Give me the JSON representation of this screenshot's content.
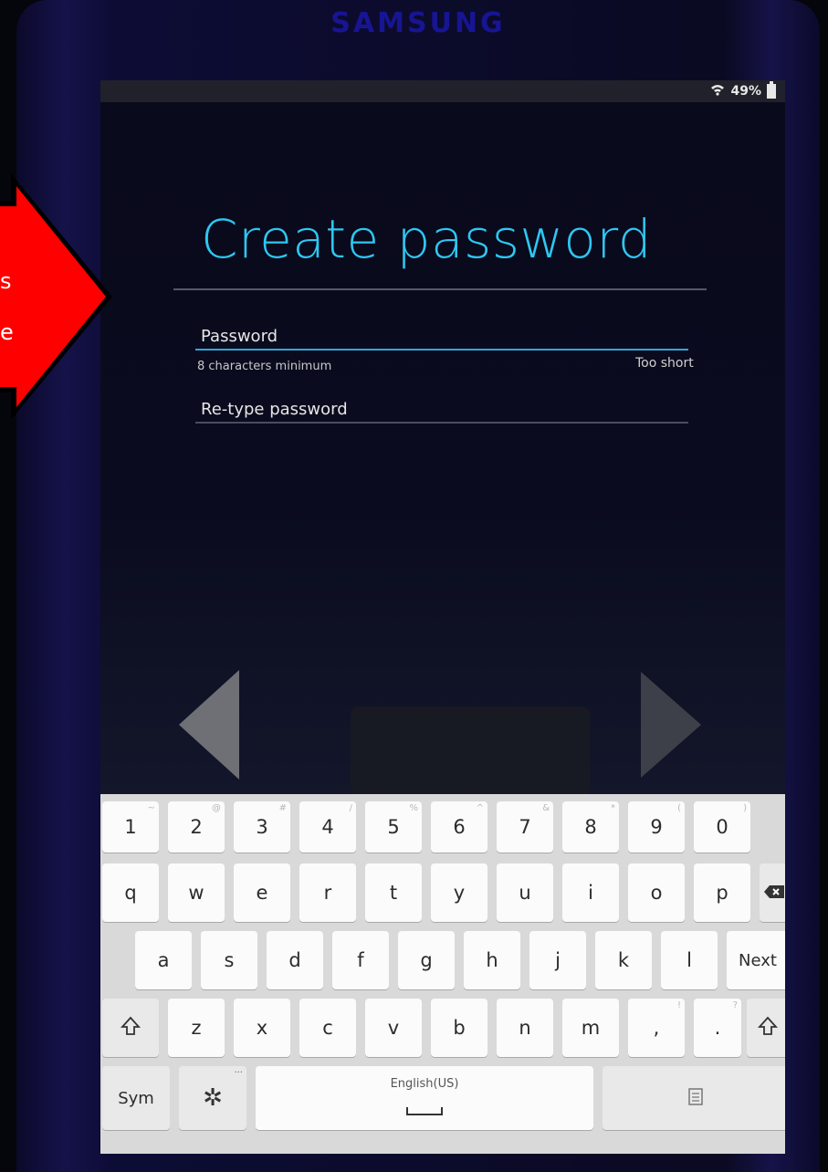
{
  "device": {
    "brand": "SAMSUNG"
  },
  "status_bar": {
    "battery": "49%"
  },
  "page": {
    "title": "Create password",
    "password_label": "Password",
    "password_hint": "8 characters minimum",
    "password_status": "Too short",
    "retype_label": "Re-type password"
  },
  "colors": {
    "accent": "#2ec7f2",
    "callout": "#ff0000"
  },
  "callout": {
    "line1": "s",
    "line2": "e"
  },
  "keyboard": {
    "row_numbers": [
      {
        "k": "1",
        "h": "~"
      },
      {
        "k": "2",
        "h": "@"
      },
      {
        "k": "3",
        "h": "#"
      },
      {
        "k": "4",
        "h": "/"
      },
      {
        "k": "5",
        "h": "%"
      },
      {
        "k": "6",
        "h": "^"
      },
      {
        "k": "7",
        "h": "&"
      },
      {
        "k": "8",
        "h": "*"
      },
      {
        "k": "9",
        "h": "("
      },
      {
        "k": "0",
        "h": ")"
      }
    ],
    "row_q": [
      "q",
      "w",
      "e",
      "r",
      "t",
      "y",
      "u",
      "i",
      "o",
      "p"
    ],
    "row_a": [
      "a",
      "s",
      "d",
      "f",
      "g",
      "h",
      "j",
      "k",
      "l"
    ],
    "row_z": [
      "z",
      "x",
      "c",
      "v",
      "b",
      "n",
      "m"
    ],
    "comma": ",",
    "comma_hint": "!",
    "period": ".",
    "period_hint": "?",
    "next_label": "Next",
    "sym_label": "Sym",
    "space_label": "English(US)",
    "settings_icon": "gear-icon",
    "shift_icon": "shift-icon",
    "backspace_icon": "backspace-icon"
  }
}
